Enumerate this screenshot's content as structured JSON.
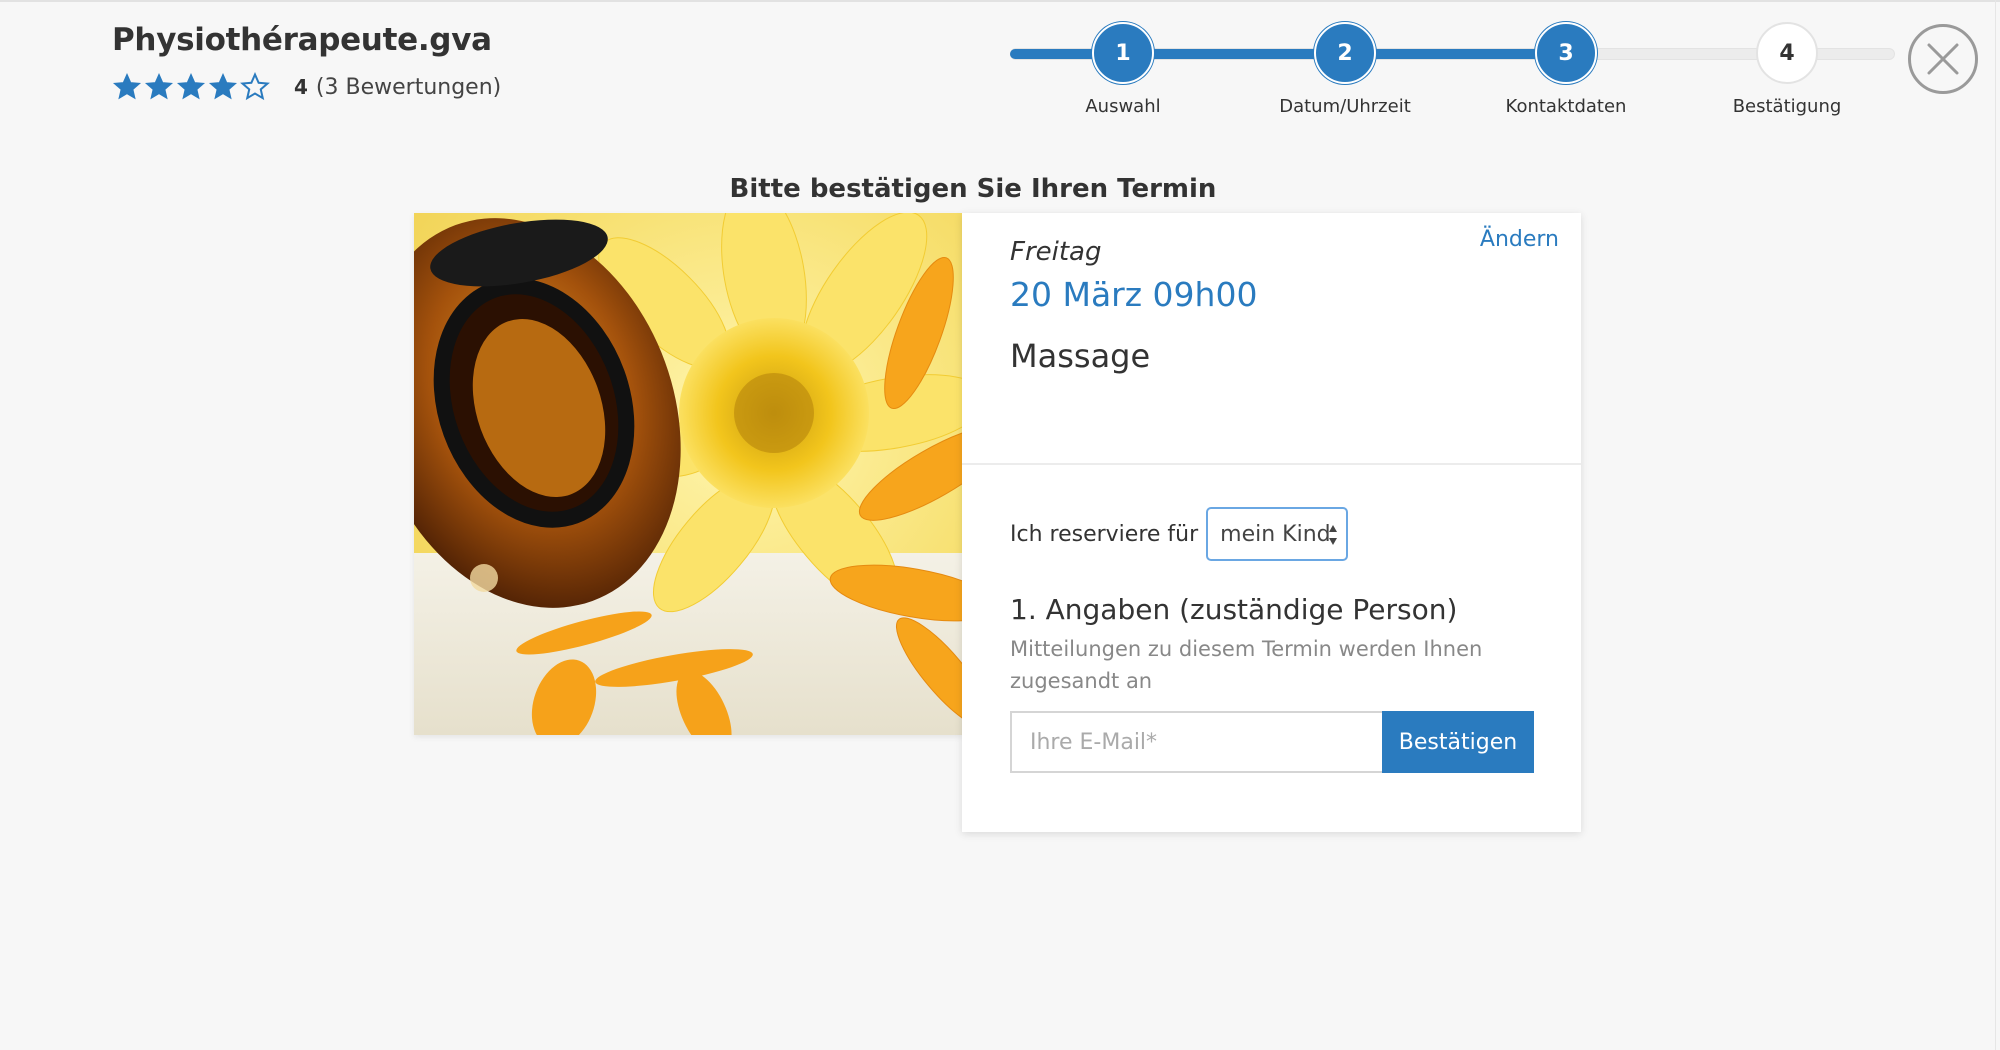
{
  "header": {
    "title": "Physiothérapeute.gva",
    "rating": {
      "stars_filled": 4,
      "stars_total": 5,
      "value": "4",
      "count_text": "(3 Bewertungen)"
    }
  },
  "stepper": {
    "steps": [
      {
        "number": "1",
        "label": "Auswahl",
        "state": "done"
      },
      {
        "number": "2",
        "label": "Datum/Uhrzeit",
        "state": "done"
      },
      {
        "number": "3",
        "label": "Kontaktdaten",
        "state": "done"
      },
      {
        "number": "4",
        "label": "Bestätigung",
        "state": "todo"
      }
    ]
  },
  "page": {
    "heading": "Bitte bestätigen Sie Ihren Termin"
  },
  "appointment": {
    "day": "Freitag",
    "datetime": "20 März 09h00",
    "service": "Massage",
    "change_label": "Ändern"
  },
  "form": {
    "reserve_label": "Ich reserviere für",
    "reserve_for_value": "mein Kind",
    "section_title": "1. Angaben (zuständige Person)",
    "section_desc": "Mitteilungen zu diesem Termin werden Ihnen zugesandt an",
    "email_placeholder": "Ihre E-Mail*",
    "email_value": "",
    "confirm_label": "Bestätigen"
  },
  "colors": {
    "accent": "#2a7bbf",
    "background": "#f7f7f7"
  }
}
